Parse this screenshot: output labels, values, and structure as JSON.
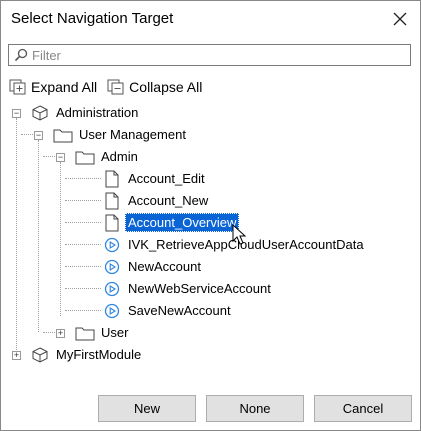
{
  "window": {
    "title": "Select Navigation Target"
  },
  "filter": {
    "placeholder": "Filter"
  },
  "toolbar": {
    "expand_all": "Expand All",
    "collapse_all": "Collapse All"
  },
  "tree": {
    "administration": "Administration",
    "user_management": "User Management",
    "admin": "Admin",
    "items": [
      "Account_Edit",
      "Account_New",
      "Account_Overview",
      "IVK_RetrieveAppCloudUserAccountData",
      "NewAccount",
      "NewWebServiceAccount",
      "SaveNewAccount"
    ],
    "user": "User",
    "my_first_module": "MyFirstModule"
  },
  "buttons": {
    "new": "New",
    "none": "None",
    "cancel": "Cancel"
  },
  "colors": {
    "selection": "#0a64d6",
    "microflow_icon": "#2e86de",
    "button_bg": "#e1e1e1"
  }
}
